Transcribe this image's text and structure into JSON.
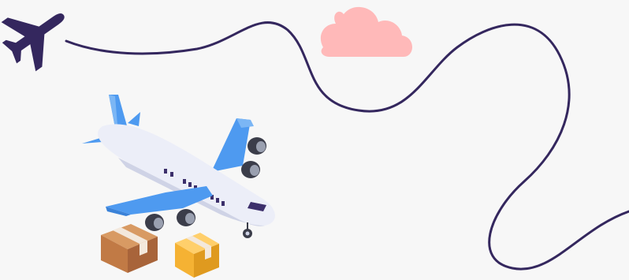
{
  "illustration": {
    "icons": [
      "airplane-silhouette-icon",
      "cloud-icon",
      "flight-path-line",
      "cargo-airplane-icon",
      "cardboard-box-icon",
      "yellow-box-icon"
    ],
    "colors": {
      "background": "#f7f7f7",
      "navy": "#34275e",
      "cloud": "#ffb9b9",
      "plane_body": "#eceef8",
      "plane_blue": "#4e9af0",
      "window": "#3c2f6b",
      "engine": "#3b3d4a",
      "box_brown": "#c17a45",
      "box_yellow": "#f5b233",
      "tape": "#f3e8dc"
    }
  }
}
